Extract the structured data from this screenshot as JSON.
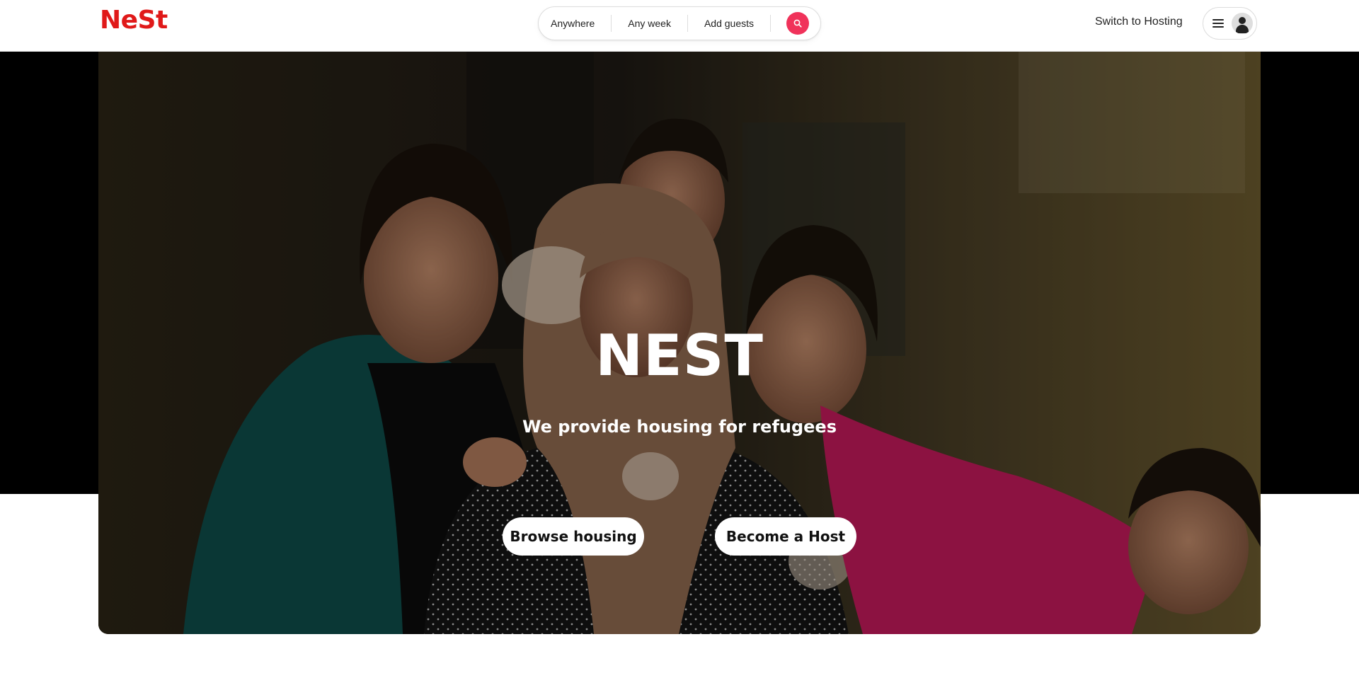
{
  "header": {
    "logo_text": "NeSt",
    "search": {
      "where": "Anywhere",
      "when": "Any week",
      "guests": "Add guests",
      "button_icon": "search-icon"
    },
    "switch_hosting": "Switch to Hosting",
    "menu_icon": "hamburger-menu-icon",
    "avatar_icon": "user-avatar-icon"
  },
  "hero": {
    "title": "NEST",
    "subtitle": "We provide housing for refugees",
    "browse_button": "Browse housing",
    "host_button": "Become a Host",
    "image": "photo of refugee family: elderly woman in headscarf with four smiling children"
  },
  "colors": {
    "brand_red": "#e01919",
    "search_button": "#f0325a"
  }
}
